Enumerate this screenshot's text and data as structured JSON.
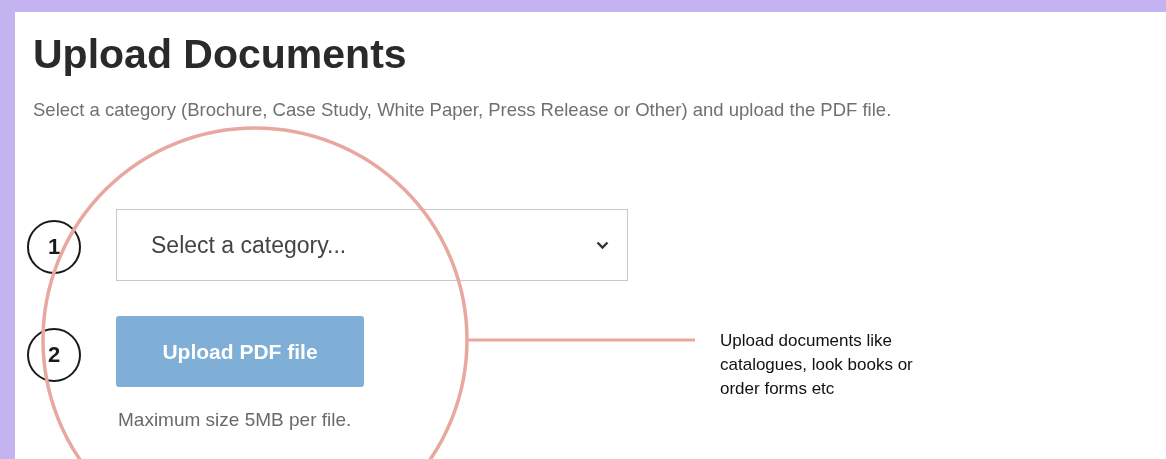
{
  "title": "Upload Documents",
  "subtitle": "Select a category (Brochure, Case Study, White Paper, Press Release or Other) and upload the PDF file.",
  "steps": [
    {
      "number": "1",
      "kind": "select",
      "placeholder": "Select a category..."
    },
    {
      "number": "2",
      "kind": "upload",
      "label": "Upload PDF file",
      "note": "Maximum size 5MB per file."
    }
  ],
  "callout": {
    "text": "Upload documents like catalogues, look books or order forms etc"
  }
}
